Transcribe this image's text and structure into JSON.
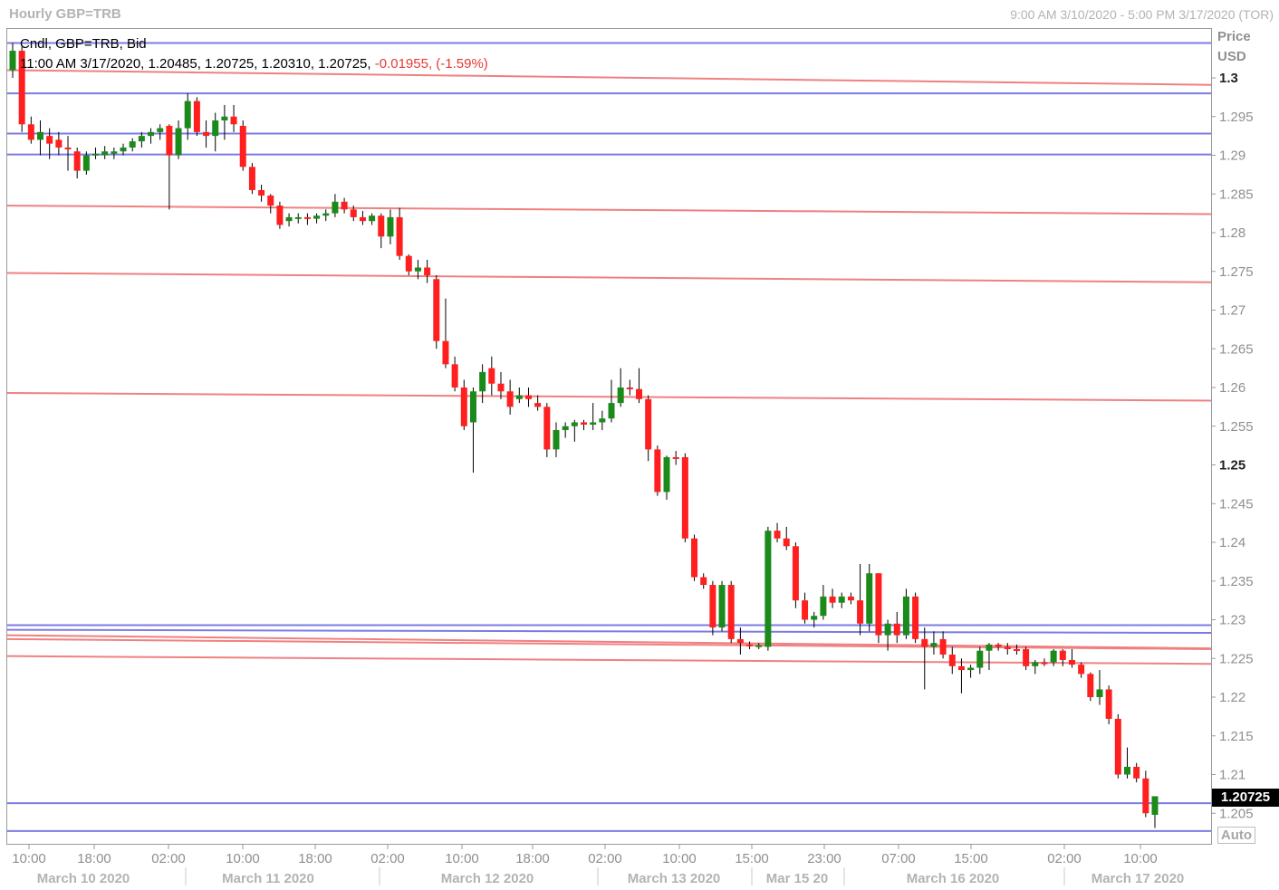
{
  "window": {
    "title": "Hourly GBP=TRB",
    "range": "9:00 AM 3/10/2020 - 5:00 PM 3/17/2020 (TOR)"
  },
  "legend": {
    "line1": "Cndl, GBP=TRB, Bid",
    "line2_prefix": "11:00 AM 3/17/2020, 1.20485, 1.20725, 1.20310, 1.20725,",
    "line2_change": "-0.01955, (-1.59%)"
  },
  "price_axis": {
    "title1": "Price",
    "title2": "USD",
    "last_price": "1.20725",
    "auto_label": "Auto",
    "ticks": [
      "1.3",
      "1.295",
      "1.29",
      "1.285",
      "1.28",
      "1.275",
      "1.27",
      "1.265",
      "1.26",
      "1.255",
      "1.25",
      "1.245",
      "1.24",
      "1.235",
      "1.23",
      "1.225",
      "1.22",
      "1.215",
      "1.21",
      "1.205"
    ],
    "bold_ticks": [
      "1.3",
      "1.25"
    ]
  },
  "time_axis": {
    "hour_labels": [
      "10:00",
      "18:00",
      "02:00",
      "10:00",
      "18:00",
      "02:00",
      "10:00",
      "18:00",
      "02:00",
      "10:00",
      "15:00",
      "23:00",
      "07:00",
      "15:00",
      "02:00",
      "10:00"
    ],
    "date_labels": [
      "March 10 2020",
      "March 11 2020",
      "March 12 2020",
      "March 13 2020",
      "Mar 15 20",
      "March 16 2020",
      "March 17 2020"
    ]
  },
  "colors": {
    "up": "#1a8a1a",
    "down": "#ff1f1f",
    "blue_line": "#7b7be6",
    "red_line": "#f08080",
    "negative_text": "#e53935"
  },
  "chart_data": {
    "type": "candlestick",
    "title": "Hourly GBP=TRB",
    "ylabel": "Price USD",
    "ylim": [
      1.2025,
      1.3055
    ],
    "series": [
      {
        "name": "Cndl, GBP=TRB, Bid",
        "ohlc": [
          [
            1.301,
            1.3045,
            1.3,
            1.3035
          ],
          [
            1.3035,
            1.304,
            1.293,
            1.294
          ],
          [
            1.294,
            1.295,
            1.2915,
            1.292
          ],
          [
            1.292,
            1.2945,
            1.29,
            1.293
          ],
          [
            1.2925,
            1.2935,
            1.2895,
            1.2915
          ],
          [
            1.292,
            1.293,
            1.29,
            1.291
          ],
          [
            1.291,
            1.2925,
            1.288,
            1.2908
          ],
          [
            1.2905,
            1.291,
            1.287,
            1.288
          ],
          [
            1.288,
            1.2905,
            1.2875,
            1.29
          ],
          [
            1.29,
            1.291,
            1.2895,
            1.2902
          ],
          [
            1.29,
            1.2912,
            1.2895,
            1.2905
          ],
          [
            1.2902,
            1.291,
            1.2895,
            1.2905
          ],
          [
            1.2905,
            1.2915,
            1.29,
            1.291
          ],
          [
            1.291,
            1.2922,
            1.2905,
            1.2918
          ],
          [
            1.2918,
            1.293,
            1.291,
            1.2925
          ],
          [
            1.2925,
            1.2935,
            1.2915,
            1.293
          ],
          [
            1.293,
            1.294,
            1.292,
            1.2935
          ],
          [
            1.2938,
            1.294,
            1.283,
            1.29
          ],
          [
            1.29,
            1.2945,
            1.2895,
            1.2935
          ],
          [
            1.2935,
            1.298,
            1.292,
            1.297
          ],
          [
            1.297,
            1.2975,
            1.2925,
            1.293
          ],
          [
            1.293,
            1.2945,
            1.291,
            1.2925
          ],
          [
            1.2925,
            1.2955,
            1.2905,
            1.2945
          ],
          [
            1.2945,
            1.2965,
            1.292,
            1.295
          ],
          [
            1.295,
            1.2965,
            1.293,
            1.294
          ],
          [
            1.2938,
            1.2945,
            1.288,
            1.2885
          ],
          [
            1.2885,
            1.289,
            1.285,
            1.2855
          ],
          [
            1.2855,
            1.2862,
            1.284,
            1.2848
          ],
          [
            1.2848,
            1.285,
            1.2825,
            1.2835
          ],
          [
            1.2835,
            1.284,
            1.2805,
            1.281
          ],
          [
            1.2815,
            1.2825,
            1.2808,
            1.282
          ],
          [
            1.2818,
            1.2825,
            1.2812,
            1.282
          ],
          [
            1.282,
            1.2825,
            1.281,
            1.2818
          ],
          [
            1.2818,
            1.2825,
            1.2812,
            1.2822
          ],
          [
            1.2822,
            1.283,
            1.2815,
            1.2825
          ],
          [
            1.2825,
            1.285,
            1.282,
            1.284
          ],
          [
            1.284,
            1.2845,
            1.2825,
            1.283
          ],
          [
            1.283,
            1.2835,
            1.2815,
            1.282
          ],
          [
            1.282,
            1.2828,
            1.281,
            1.2815
          ],
          [
            1.2815,
            1.2825,
            1.281,
            1.2822
          ],
          [
            1.2822,
            1.2825,
            1.278,
            1.2795
          ],
          [
            1.2795,
            1.283,
            1.2785,
            1.282
          ],
          [
            1.282,
            1.2832,
            1.2765,
            1.277
          ],
          [
            1.277,
            1.2772,
            1.2745,
            1.275
          ],
          [
            1.275,
            1.2765,
            1.274,
            1.2755
          ],
          [
            1.2755,
            1.2765,
            1.2735,
            1.2745
          ],
          [
            1.274,
            1.2745,
            1.265,
            1.266
          ],
          [
            1.266,
            1.2715,
            1.2625,
            1.263
          ],
          [
            1.263,
            1.264,
            1.2595,
            1.26
          ],
          [
            1.26,
            1.261,
            1.2545,
            1.255
          ],
          [
            1.2555,
            1.26,
            1.249,
            1.2595
          ],
          [
            1.2595,
            1.263,
            1.258,
            1.262
          ],
          [
            1.2625,
            1.264,
            1.259,
            1.2605
          ],
          [
            1.2605,
            1.262,
            1.2585,
            1.2595
          ],
          [
            1.2595,
            1.261,
            1.2565,
            1.2575
          ],
          [
            1.2585,
            1.26,
            1.258,
            1.259
          ],
          [
            1.259,
            1.26,
            1.2575,
            1.2585
          ],
          [
            1.258,
            1.259,
            1.257,
            1.2575
          ],
          [
            1.2575,
            1.258,
            1.251,
            1.252
          ],
          [
            1.252,
            1.2555,
            1.251,
            1.2545
          ],
          [
            1.2545,
            1.2555,
            1.2535,
            1.255
          ],
          [
            1.255,
            1.2558,
            1.253,
            1.2555
          ],
          [
            1.2555,
            1.2558,
            1.2545,
            1.2552
          ],
          [
            1.2552,
            1.258,
            1.2545,
            1.2555
          ],
          [
            1.2555,
            1.257,
            1.2545,
            1.256
          ],
          [
            1.256,
            1.261,
            1.2555,
            1.258
          ],
          [
            1.258,
            1.2625,
            1.2575,
            1.26
          ],
          [
            1.26,
            1.261,
            1.259,
            1.2598
          ],
          [
            1.2598,
            1.2625,
            1.258,
            1.2585
          ],
          [
            1.2585,
            1.259,
            1.2505,
            1.252
          ],
          [
            1.252,
            1.2525,
            1.246,
            1.2465
          ],
          [
            1.2465,
            1.2512,
            1.2455,
            1.251
          ],
          [
            1.251,
            1.2518,
            1.25,
            1.2508
          ],
          [
            1.251,
            1.2515,
            1.24,
            1.2405
          ],
          [
            1.2405,
            1.241,
            1.235,
            1.2355
          ],
          [
            1.2355,
            1.236,
            1.234,
            1.2345
          ],
          [
            1.2345,
            1.235,
            1.228,
            1.229
          ],
          [
            1.229,
            1.235,
            1.2285,
            1.2345
          ],
          [
            1.2345,
            1.235,
            1.227,
            1.2275
          ],
          [
            1.2275,
            1.229,
            1.2255,
            1.227
          ],
          [
            1.2268,
            1.2272,
            1.2262,
            1.2267
          ],
          [
            1.2265,
            1.227,
            1.2262,
            1.2267
          ],
          [
            1.2265,
            1.242,
            1.226,
            1.2415
          ],
          [
            1.2415,
            1.2425,
            1.24,
            1.2405
          ],
          [
            1.2405,
            1.242,
            1.239,
            1.2395
          ],
          [
            1.2395,
            1.24,
            1.2315,
            1.2325
          ],
          [
            1.2325,
            1.2335,
            1.2295,
            1.23
          ],
          [
            1.23,
            1.231,
            1.229,
            1.2305
          ],
          [
            1.2305,
            1.2345,
            1.23,
            1.233
          ],
          [
            1.233,
            1.234,
            1.2315,
            1.2322
          ],
          [
            1.2322,
            1.2335,
            1.2315,
            1.233
          ],
          [
            1.233,
            1.2335,
            1.232,
            1.2325
          ],
          [
            1.2325,
            1.2372,
            1.228,
            1.2295
          ],
          [
            1.2295,
            1.2372,
            1.2285,
            1.236
          ],
          [
            1.236,
            1.236,
            1.227,
            1.228
          ],
          [
            1.228,
            1.23,
            1.226,
            1.2295
          ],
          [
            1.2295,
            1.231,
            1.227,
            1.228
          ],
          [
            1.228,
            1.234,
            1.2275,
            1.233
          ],
          [
            1.233,
            1.2335,
            1.227,
            1.2275
          ],
          [
            1.2275,
            1.229,
            1.221,
            1.2265
          ],
          [
            1.2265,
            1.2285,
            1.2255,
            1.227
          ],
          [
            1.2275,
            1.2285,
            1.225,
            1.2255
          ],
          [
            1.2255,
            1.2265,
            1.223,
            1.224
          ],
          [
            1.224,
            1.225,
            1.2205,
            1.2235
          ],
          [
            1.2235,
            1.2242,
            1.2225,
            1.2238
          ],
          [
            1.2238,
            1.2265,
            1.223,
            1.226
          ],
          [
            1.226,
            1.227,
            1.2235,
            1.2268
          ],
          [
            1.2268,
            1.227,
            1.226,
            1.2265
          ],
          [
            1.2265,
            1.227,
            1.2255,
            1.2262
          ],
          [
            1.2262,
            1.2268,
            1.2255,
            1.226
          ],
          [
            1.2262,
            1.2265,
            1.2235,
            1.224
          ],
          [
            1.224,
            1.2248,
            1.223,
            1.2245
          ],
          [
            1.2245,
            1.225,
            1.224,
            1.2243
          ],
          [
            1.2245,
            1.2262,
            1.224,
            1.226
          ],
          [
            1.226,
            1.2262,
            1.224,
            1.2248
          ],
          [
            1.2248,
            1.2262,
            1.2238,
            1.2242
          ],
          [
            1.2242,
            1.2245,
            1.2225,
            1.223
          ],
          [
            1.223,
            1.2232,
            1.2195,
            1.22
          ],
          [
            1.22,
            1.2235,
            1.219,
            1.221
          ],
          [
            1.221,
            1.2215,
            1.2165,
            1.2172
          ],
          [
            1.2172,
            1.2178,
            1.2095,
            1.21
          ],
          [
            1.21,
            1.2135,
            1.2095,
            1.211
          ],
          [
            1.211,
            1.2115,
            1.209,
            1.2095
          ],
          [
            1.2095,
            1.2105,
            1.2045,
            1.205
          ],
          [
            1.2048,
            1.2072,
            1.2031,
            1.2072
          ]
        ]
      }
    ],
    "horizontal_lines": [
      {
        "color": "blue",
        "y_left": 1.3045,
        "y_right": 1.3045
      },
      {
        "color": "red",
        "y_left": 1.301,
        "y_right": 1.2991
      },
      {
        "color": "blue",
        "y_left": 1.298,
        "y_right": 1.298
      },
      {
        "color": "blue",
        "y_left": 1.2928,
        "y_right": 1.2928
      },
      {
        "color": "blue",
        "y_left": 1.2901,
        "y_right": 1.2901
      },
      {
        "color": "red",
        "y_left": 1.2835,
        "y_right": 1.2824
      },
      {
        "color": "red",
        "y_left": 1.2748,
        "y_right": 1.2736
      },
      {
        "color": "red",
        "y_left": 1.2593,
        "y_right": 1.2583
      },
      {
        "color": "blue",
        "y_left": 1.2293,
        "y_right": 1.2293
      },
      {
        "color": "blue",
        "y_left": 1.2287,
        "y_right": 1.2283
      },
      {
        "color": "red",
        "y_left": 1.228,
        "y_right": 1.2263
      },
      {
        "color": "red",
        "y_left": 1.2275,
        "y_right": 1.2262
      },
      {
        "color": "red",
        "y_left": 1.2253,
        "y_right": 1.2243
      },
      {
        "color": "blue",
        "y_left": 1.2063,
        "y_right": 1.2063
      },
      {
        "color": "blue",
        "y_left": 1.2027,
        "y_right": 1.2027
      }
    ]
  }
}
